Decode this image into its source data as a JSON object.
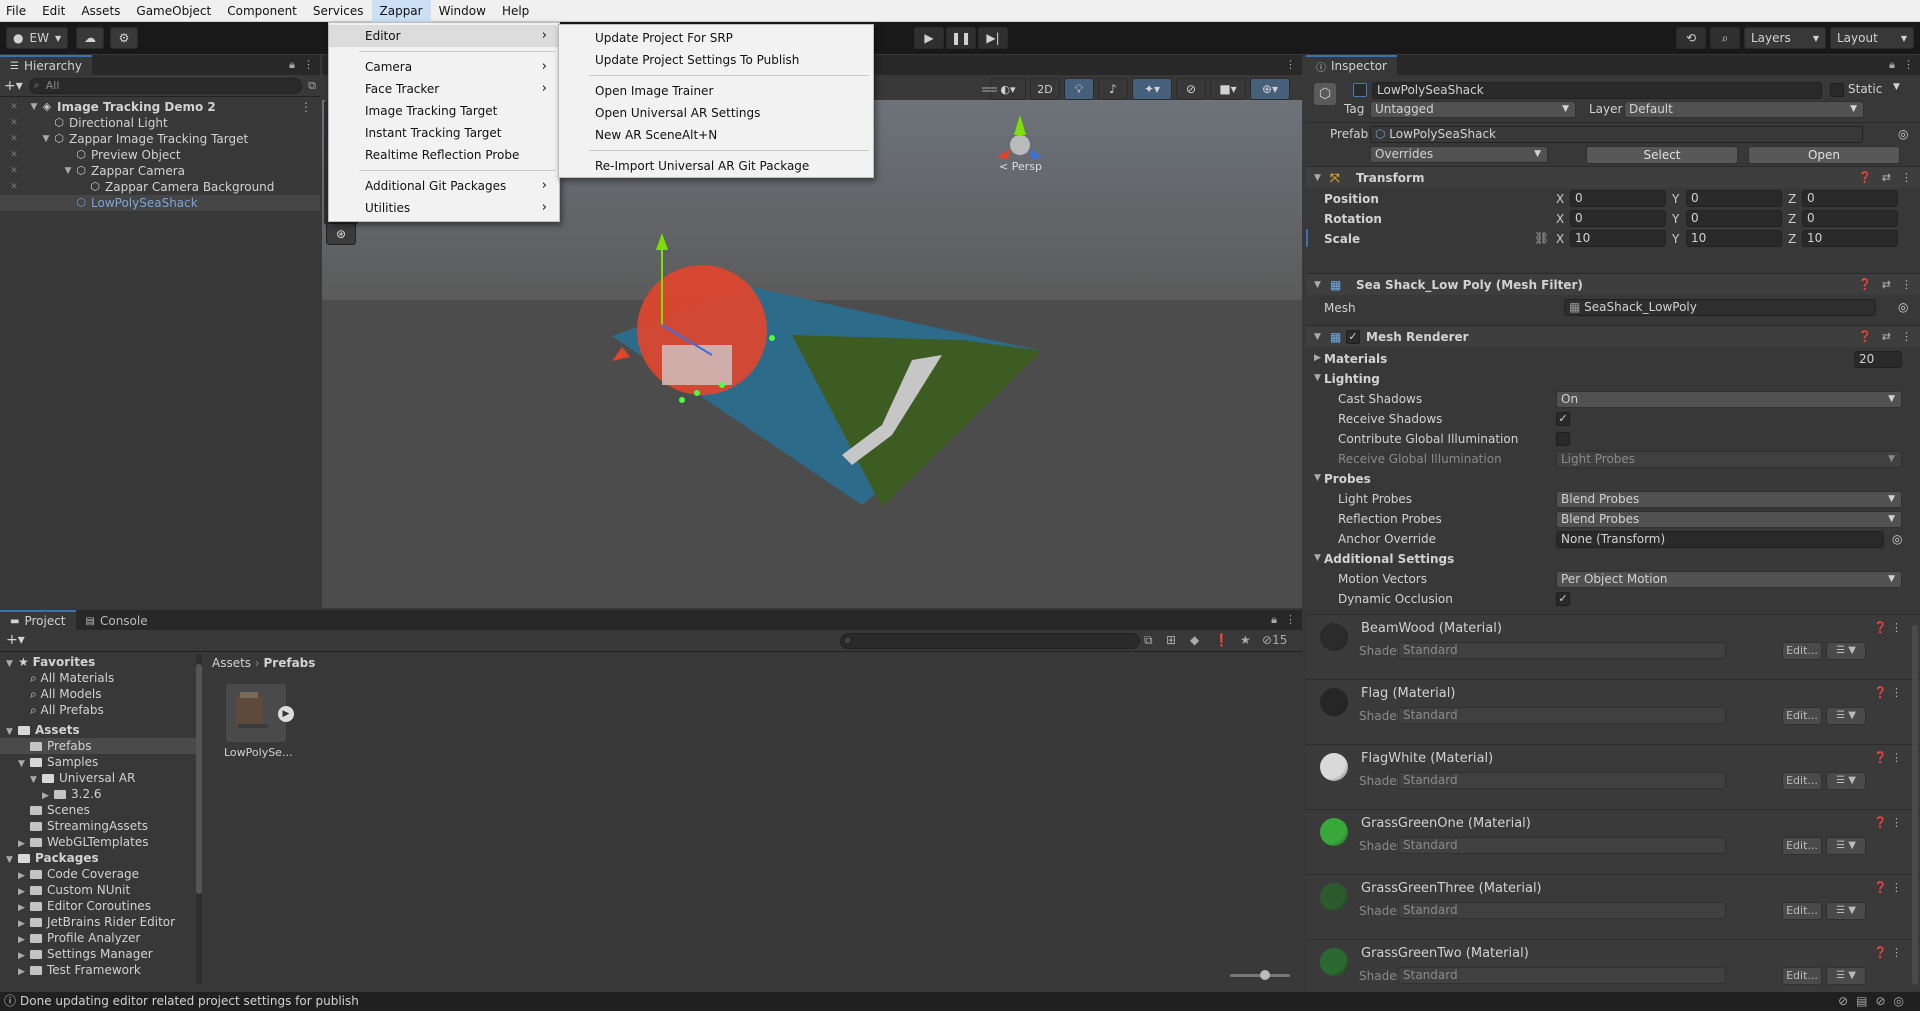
{
  "menubar": {
    "items": [
      "File",
      "Edit",
      "Assets",
      "GameObject",
      "Component",
      "Services",
      "Zappar",
      "Window",
      "Help"
    ]
  },
  "toolbar": {
    "account": "EW",
    "layers": "Layers",
    "layout": "Layout"
  },
  "zappar_menu": {
    "items": [
      {
        "label": "Editor",
        "sub": true
      },
      {
        "label": "Camera",
        "sub": true
      },
      {
        "label": "Face Tracker",
        "sub": true
      },
      {
        "label": "Image Tracking Target",
        "sub": false
      },
      {
        "label": "Instant Tracking Target",
        "sub": false
      },
      {
        "label": "Realtime Reflection Probe",
        "sub": false
      },
      {
        "label": "Additional Git Packages",
        "sub": true
      },
      {
        "label": "Utilities",
        "sub": true
      }
    ]
  },
  "editor_submenu": {
    "items": [
      {
        "label": "Update Project For SRP",
        "shortcut": ""
      },
      {
        "label": "Update Project Settings To Publish",
        "shortcut": ""
      },
      {
        "label": "Open Image Trainer",
        "shortcut": ""
      },
      {
        "label": "Open Universal AR Settings",
        "shortcut": ""
      },
      {
        "label": "New AR Scene",
        "shortcut": "Alt+N"
      },
      {
        "label": "Re-Import Universal AR Git Package",
        "shortcut": ""
      }
    ]
  },
  "hierarchy": {
    "tab": "Hierarchy",
    "search_placeholder": "All",
    "rows": [
      {
        "label": "Image Tracking Demo 2",
        "indent": 0
      },
      {
        "label": "Directional Light",
        "indent": 1
      },
      {
        "label": "Zappar Image Tracking Target",
        "indent": 1
      },
      {
        "label": "Preview Object",
        "indent": 2
      },
      {
        "label": "Zappar Camera",
        "indent": 2
      },
      {
        "label": "Zappar Camera Background",
        "indent": 3
      },
      {
        "label": "LowPolySeaShack",
        "indent": 2
      }
    ]
  },
  "scene": {
    "mode_2d": "2D",
    "persp": "< Persp"
  },
  "inspector": {
    "tab": "Inspector",
    "object_name": "LowPolySeaShack",
    "static_label": "Static",
    "tag_label": "Tag",
    "tag_value": "Untagged",
    "layer_label": "Layer",
    "layer_value": "Default",
    "prefab_label": "Prefab",
    "prefab_value": "LowPolySeaShack",
    "overrides": "Overrides",
    "select": "Select",
    "open": "Open",
    "transform": {
      "title": "Transform",
      "position_label": "Position",
      "rotation_label": "Rotation",
      "scale_label": "Scale",
      "position": [
        "0",
        "0",
        "0"
      ],
      "rotation": [
        "0",
        "0",
        "0"
      ],
      "scale": [
        "10",
        "10",
        "10"
      ]
    },
    "mesh_filter": {
      "title": "Sea Shack_Low Poly (Mesh Filter)",
      "mesh_label": "Mesh",
      "mesh_value": "SeaShack_LowPoly"
    },
    "mesh_renderer": {
      "title": "Mesh Renderer",
      "materials_label": "Materials",
      "materials_count": "20",
      "lighting": "Lighting",
      "cast_shadows_label": "Cast Shadows",
      "cast_shadows_value": "On",
      "receive_shadows_label": "Receive Shadows",
      "contribute_gi_label": "Contribute Global Illumination",
      "receive_gi_label": "Receive Global Illumination",
      "receive_gi_value": "Light Probes",
      "probes": "Probes",
      "light_probes_label": "Light Probes",
      "light_probes_value": "Blend Probes",
      "reflection_probes_label": "Reflection Probes",
      "reflection_probes_value": "Blend Probes",
      "anchor_override_label": "Anchor Override",
      "anchor_override_value": "None (Transform)",
      "additional": "Additional Settings",
      "motion_vectors_label": "Motion Vectors",
      "motion_vectors_value": "Per Object Motion",
      "dynamic_occlusion_label": "Dynamic Occlusion"
    },
    "materials": [
      {
        "name": "BeamWood (Material)",
        "color": "#2b2b2b"
      },
      {
        "name": "Flag (Material)",
        "color": "#262626"
      },
      {
        "name": "FlagWhite (Material)",
        "color": "#d9d9d9"
      },
      {
        "name": "GrassGreenOne (Material)",
        "color": "#39a83a"
      },
      {
        "name": "GrassGreenThree (Material)",
        "color": "#2d5a2d"
      },
      {
        "name": "GrassGreenTwo (Material)",
        "color": "#2a6a30"
      }
    ],
    "shader_label": "Shader",
    "shader_value": "Standard",
    "edit_label": "Edit..."
  },
  "project": {
    "tab_project": "Project",
    "tab_console": "Console",
    "hidden_count": "15",
    "breadcrumb": [
      "Assets",
      "Prefabs"
    ],
    "asset_label": "LowPolySe...",
    "tree": [
      {
        "label": "Favorites",
        "indent": 0,
        "bold": true,
        "kind": "star"
      },
      {
        "label": "All Materials",
        "indent": 1,
        "kind": "search"
      },
      {
        "label": "All Models",
        "indent": 1,
        "kind": "search"
      },
      {
        "label": "All Prefabs",
        "indent": 1,
        "kind": "search"
      },
      {
        "label": "Assets",
        "indent": 0,
        "bold": true,
        "kind": "folder"
      },
      {
        "label": "Prefabs",
        "indent": 1,
        "kind": "folder",
        "selected": true
      },
      {
        "label": "Samples",
        "indent": 1,
        "kind": "folder"
      },
      {
        "label": "Universal AR",
        "indent": 2,
        "kind": "folder"
      },
      {
        "label": "3.2.6",
        "indent": 3,
        "kind": "folder"
      },
      {
        "label": "Scenes",
        "indent": 1,
        "kind": "folder"
      },
      {
        "label": "StreamingAssets",
        "indent": 1,
        "kind": "folder"
      },
      {
        "label": "WebGLTemplates",
        "indent": 1,
        "kind": "folder"
      },
      {
        "label": "Packages",
        "indent": 0,
        "bold": true,
        "kind": "folder"
      },
      {
        "label": "Code Coverage",
        "indent": 1,
        "kind": "folder"
      },
      {
        "label": "Custom NUnit",
        "indent": 1,
        "kind": "folder"
      },
      {
        "label": "Editor Coroutines",
        "indent": 1,
        "kind": "folder"
      },
      {
        "label": "JetBrains Rider Editor",
        "indent": 1,
        "kind": "folder"
      },
      {
        "label": "Profile Analyzer",
        "indent": 1,
        "kind": "folder"
      },
      {
        "label": "Settings Manager",
        "indent": 1,
        "kind": "folder"
      },
      {
        "label": "Test Framework",
        "indent": 1,
        "kind": "folder"
      }
    ]
  },
  "status": {
    "message": "Done updating editor related project settings for publish"
  }
}
